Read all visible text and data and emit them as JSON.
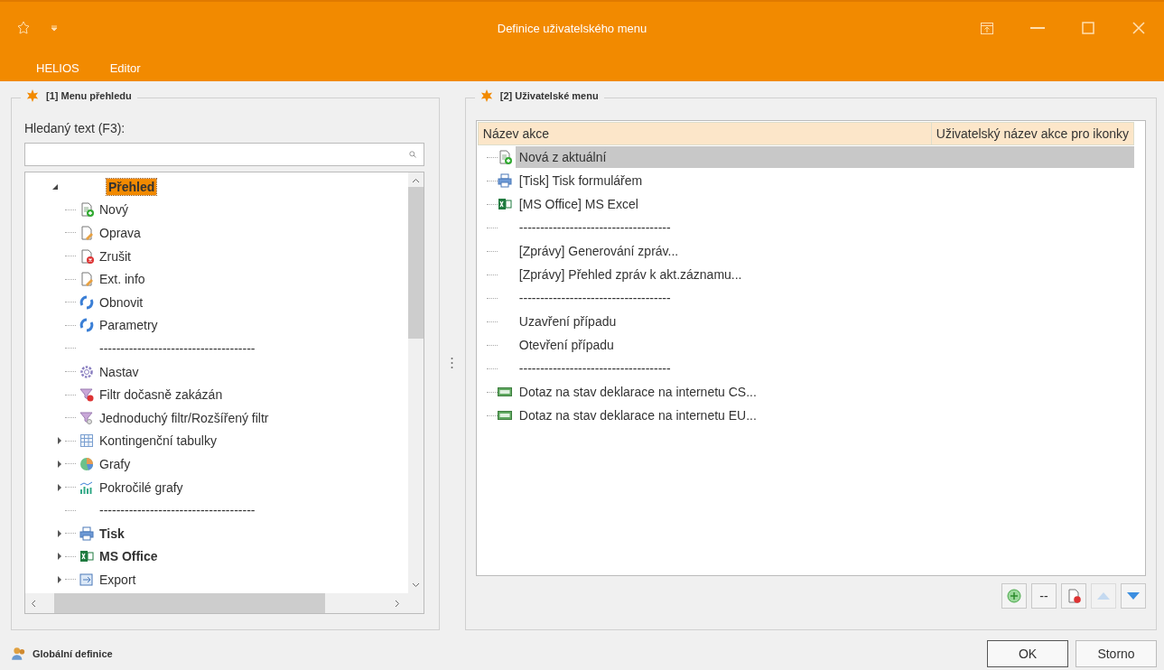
{
  "window": {
    "title": "Definice uživatelského menu"
  },
  "menu": [
    {
      "label": "HELIOS"
    },
    {
      "label": "Editor"
    }
  ],
  "left": {
    "legend": "[1] Menu přehledu",
    "search_label": "Hledaný text (F3):",
    "tree": [
      {
        "label": "Přehled",
        "expanded": true,
        "selected": true,
        "bold": true,
        "children": [
          {
            "label": "Nový",
            "kind": "new",
            "bold": false,
            "selected": false
          },
          {
            "label": "Oprava",
            "kind": "edit",
            "bold": false,
            "selected": false
          },
          {
            "label": "Zrušit",
            "kind": "delete",
            "bold": false,
            "selected": false
          },
          {
            "label": "Ext. info",
            "kind": "edit",
            "bold": false,
            "selected": false
          },
          {
            "label": "Obnovit",
            "kind": "refresh",
            "bold": false,
            "selected": false
          },
          {
            "label": "Parametry",
            "kind": "refresh",
            "bold": false,
            "selected": false
          },
          {
            "label": "-------------------------------------",
            "kind": "separator"
          },
          {
            "label": "Nastav",
            "kind": "settings",
            "bold": false,
            "selected": false
          },
          {
            "label": "Filtr dočasně zakázán",
            "kind": "filter-off",
            "bold": false,
            "selected": false
          },
          {
            "label": "Jednoduchý filtr/Rozšířený filtr",
            "kind": "filter",
            "bold": false,
            "selected": false
          },
          {
            "label": "Kontingenční tabulky",
            "kind": "pivot",
            "expanded": false,
            "bold": false,
            "selected": false
          },
          {
            "label": "Grafy",
            "kind": "charts",
            "expanded": false,
            "bold": false,
            "selected": false
          },
          {
            "label": "Pokročilé grafy",
            "kind": "advanced-charts",
            "expanded": false,
            "bold": false,
            "selected": false
          },
          {
            "label": "-------------------------------------",
            "kind": "separator"
          },
          {
            "label": "Tisk",
            "kind": "print",
            "expanded": false,
            "bold": true,
            "selected": false
          },
          {
            "label": "MS Office",
            "kind": "office",
            "expanded": false,
            "bold": true,
            "selected": false
          },
          {
            "label": "Export",
            "kind": "export",
            "expanded": false,
            "bold": false,
            "selected": false
          }
        ]
      }
    ]
  },
  "right": {
    "legend": "[2] Uživatelské menu",
    "columns": [
      "Název akce",
      "Uživatelský název akce pro ikonky"
    ],
    "rows": [
      {
        "label": "Nová z aktuální",
        "kind": "new",
        "selected": true
      },
      {
        "label": "[Tisk] Tisk formulářem",
        "kind": "print",
        "selected": false
      },
      {
        "label": "[MS Office] MS Excel",
        "kind": "office",
        "selected": false
      },
      {
        "label": "------------------------------------",
        "kind": "plain",
        "selected": false
      },
      {
        "label": "[Zprávy] Generování zpráv...",
        "kind": "plain",
        "selected": false
      },
      {
        "label": "[Zprávy] Přehled zpráv k akt.záznamu...",
        "kind": "plain",
        "selected": false
      },
      {
        "label": "------------------------------------",
        "kind": "plain",
        "selected": false
      },
      {
        "label": "Uzavření případu",
        "kind": "plain",
        "selected": false
      },
      {
        "label": "Otevření případu",
        "kind": "plain",
        "selected": false
      },
      {
        "label": "------------------------------------",
        "kind": "plain",
        "selected": false
      },
      {
        "label": "Dotaz na stav deklarace na internetu CS...",
        "kind": "web",
        "selected": false
      },
      {
        "label": "Dotaz na stav deklarace na internetu EU...",
        "kind": "web",
        "selected": false
      }
    ],
    "toolbar": [
      {
        "kind": "add",
        "disabled": false
      },
      {
        "kind": "text",
        "label": "--",
        "disabled": false
      },
      {
        "kind": "delete",
        "disabled": false
      },
      {
        "kind": "up",
        "disabled": true
      },
      {
        "kind": "down",
        "disabled": false
      }
    ]
  },
  "footer": {
    "global": "Globální definice",
    "buttons": [
      {
        "label": "OK",
        "default": true
      },
      {
        "label": "Storno",
        "default": false
      }
    ]
  }
}
